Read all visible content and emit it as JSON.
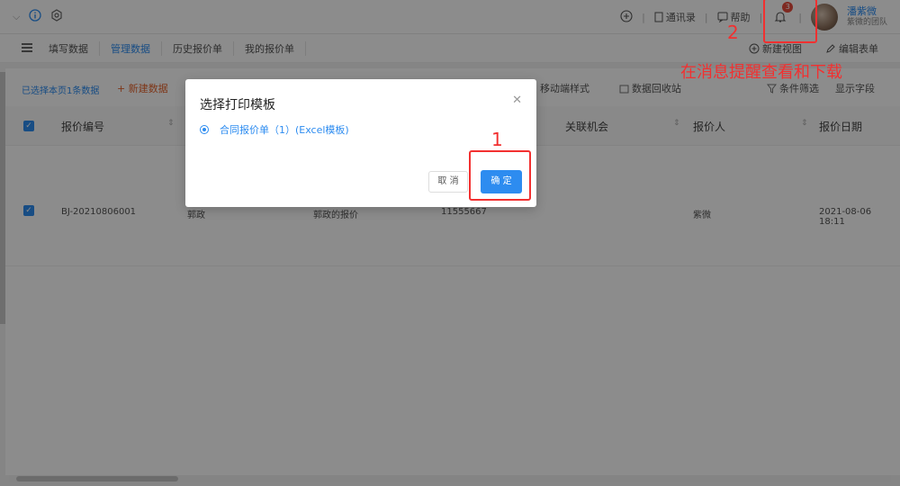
{
  "header": {
    "right_links": [
      "通讯录",
      "帮助"
    ],
    "notification_count": "3",
    "user_name": "潘紫微",
    "team_name": "紫微的团队"
  },
  "tabs": {
    "items": [
      "填写数据",
      "管理数据",
      "历史报价单",
      "我的报价单"
    ],
    "active_index": 1,
    "new_view": "新建视图",
    "edit_form": "编辑表单"
  },
  "toolbar": {
    "selected_info": "已选择本页1条数据",
    "new_data": "+ 新建数据",
    "mobile_style": "移动端样式",
    "data_recycle": "数据回收站",
    "filter": "条件筛选",
    "show_fields": "显示字段"
  },
  "table": {
    "headers": [
      "报价编号",
      "关联机会",
      "报价人",
      "报价日期"
    ],
    "row": {
      "id": "BJ-20210806001",
      "col2": "郭政",
      "col3": "郭政的报价",
      "col4": "11555667",
      "quoter": "紫微",
      "date": "2021-08-06 18:11"
    }
  },
  "modal": {
    "title": "选择打印模板",
    "option": "合同报价单（1）(Excel模板)",
    "cancel": "取 消",
    "ok": "确 定"
  },
  "annotations": {
    "step1": "1",
    "step2": "2",
    "note": "在消息提醒查看和下载"
  },
  "colors": {
    "accent": "#2d8cf0",
    "annotation": "#f23030"
  }
}
